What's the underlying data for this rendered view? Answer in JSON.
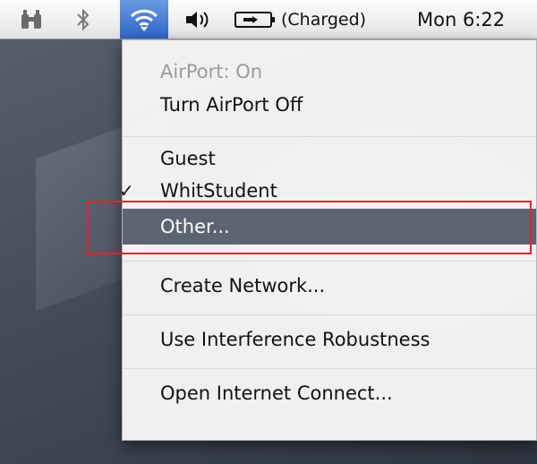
{
  "menubar": {
    "icons": {
      "spotlight": "binoculars-icon",
      "bluetooth": "bluetooth-icon",
      "wifi": "wifi-icon",
      "volume": "volume-icon",
      "battery": "battery-icon"
    },
    "battery_status": "(Charged)",
    "clock": "Mon 6:22"
  },
  "airport_menu": {
    "status": "AirPort: On",
    "toggle": "Turn AirPort Off",
    "networks": [
      {
        "label": "Guest",
        "checked": false
      },
      {
        "label": "WhitStudent",
        "checked": true
      },
      {
        "label": "Other...",
        "checked": false
      }
    ],
    "checkmark": "✓",
    "create_network": "Create Network...",
    "interference": "Use Interference Robustness",
    "open_connect": "Open Internet Connect..."
  },
  "colors": {
    "highlight_box": "#e8212a",
    "selected_item_bg": "#5b6472",
    "wifi_active_bg": "#2f66c9"
  }
}
